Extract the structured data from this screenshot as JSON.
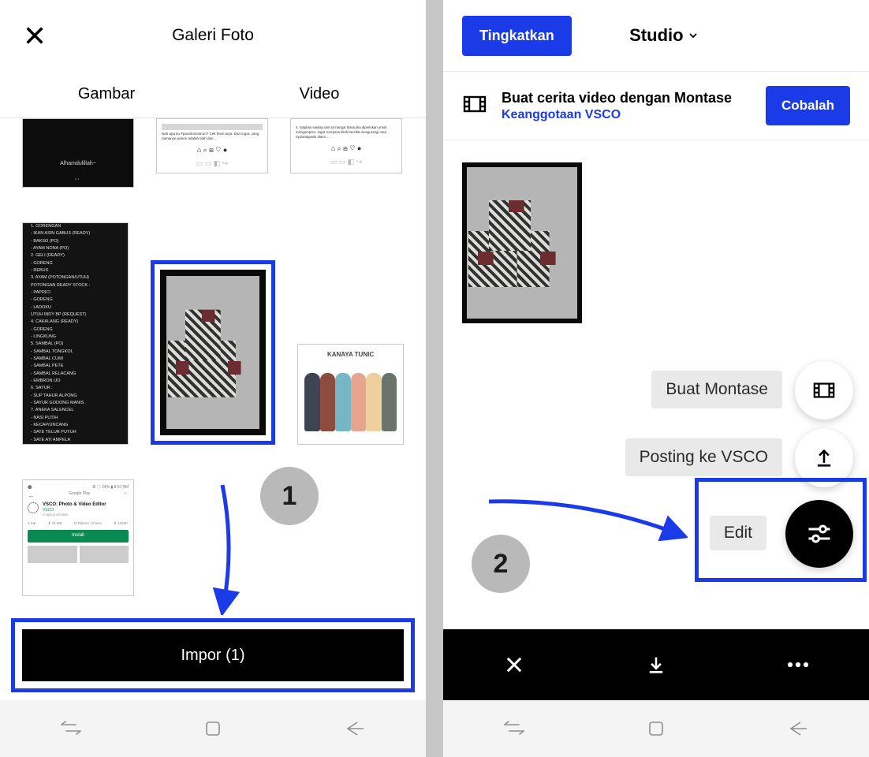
{
  "gallery": {
    "title": "Galeri Foto",
    "tabs": {
      "images": "Gambar",
      "video": "Video"
    },
    "thumbs": {
      "t1a": "Alhamdulillah~",
      "t2c_title": "KANAYA TUNIC",
      "playstore": {
        "app_name": "VSCO: Photo & Video Editor",
        "vendor": "VSCO",
        "rating": "4.3★",
        "install": "Install",
        "header_right": "≣ ⓘ 24% ▮ 8:57 AM",
        "gp": "Google Play"
      }
    },
    "import_label": "Impor (1)",
    "step": "1"
  },
  "studio": {
    "upgrade": "Tingkatkan",
    "title": "Studio",
    "banner": {
      "heading": "Buat cerita video dengan Montase",
      "link": "Keanggotaan VSCO",
      "cta": "Cobalah"
    },
    "pills": {
      "montase": "Buat Montase",
      "posting": "Posting ke VSCO",
      "edit": "Edit"
    },
    "step": "2"
  }
}
